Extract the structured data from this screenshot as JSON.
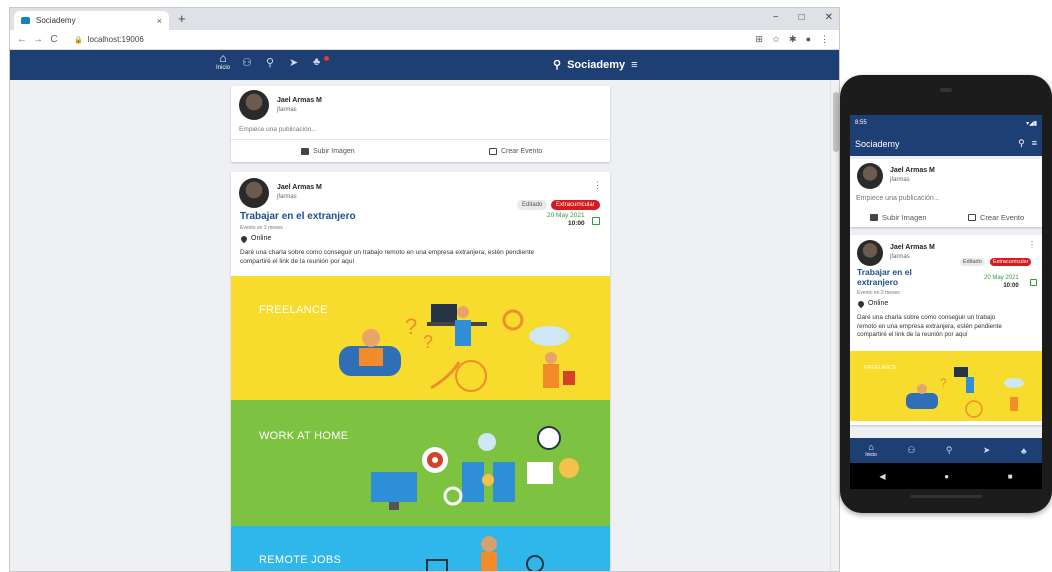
{
  "browser": {
    "tab_title": "Sociademy",
    "tab_close": "×",
    "new_tab": "+",
    "url": "localhost:19006",
    "window_controls": [
      "−",
      "□",
      "✕"
    ],
    "nav": [
      "←",
      "→",
      "C"
    ]
  },
  "app": {
    "brand": "Sociademy",
    "home_label": "Inicio",
    "accent": "#1e3f73"
  },
  "composer": {
    "user_name": "Jael Armas M",
    "user_handle": "jfarmas",
    "placeholder": "Empiece una publicación...",
    "upload_label": "Subir Imagen",
    "event_label": "Crear Evento"
  },
  "post": {
    "user_name": "Jael Armas M",
    "user_handle": "jfarmas",
    "badge_edit": "Editado",
    "badge_category": "Extracurricular",
    "title": "Trabajar en el extranjero",
    "title_line1": "Trabajar en el",
    "title_line2": "extranjero",
    "subtitle": "Evento en 2 meses",
    "date": "20 May 2021",
    "time": "10:00",
    "location": "Online",
    "body_line1": "Daré una charla sobre como conseguir un trabajo remoto en una empresa extranjera, estén pendiente",
    "body_line2": "compartiré el link de la reunión por aquí",
    "images": [
      "FREELANCE",
      "WORK AT HOME",
      "REMOTE JOBS"
    ]
  },
  "phone": {
    "time": "8:55",
    "body_p1": "Daré una charla sobre como conseguir un trabajo",
    "body_p2": "remoto en una empresa extranjera, estén pendiente",
    "body_p3": "compartiré el link de la reunión por aquí"
  }
}
